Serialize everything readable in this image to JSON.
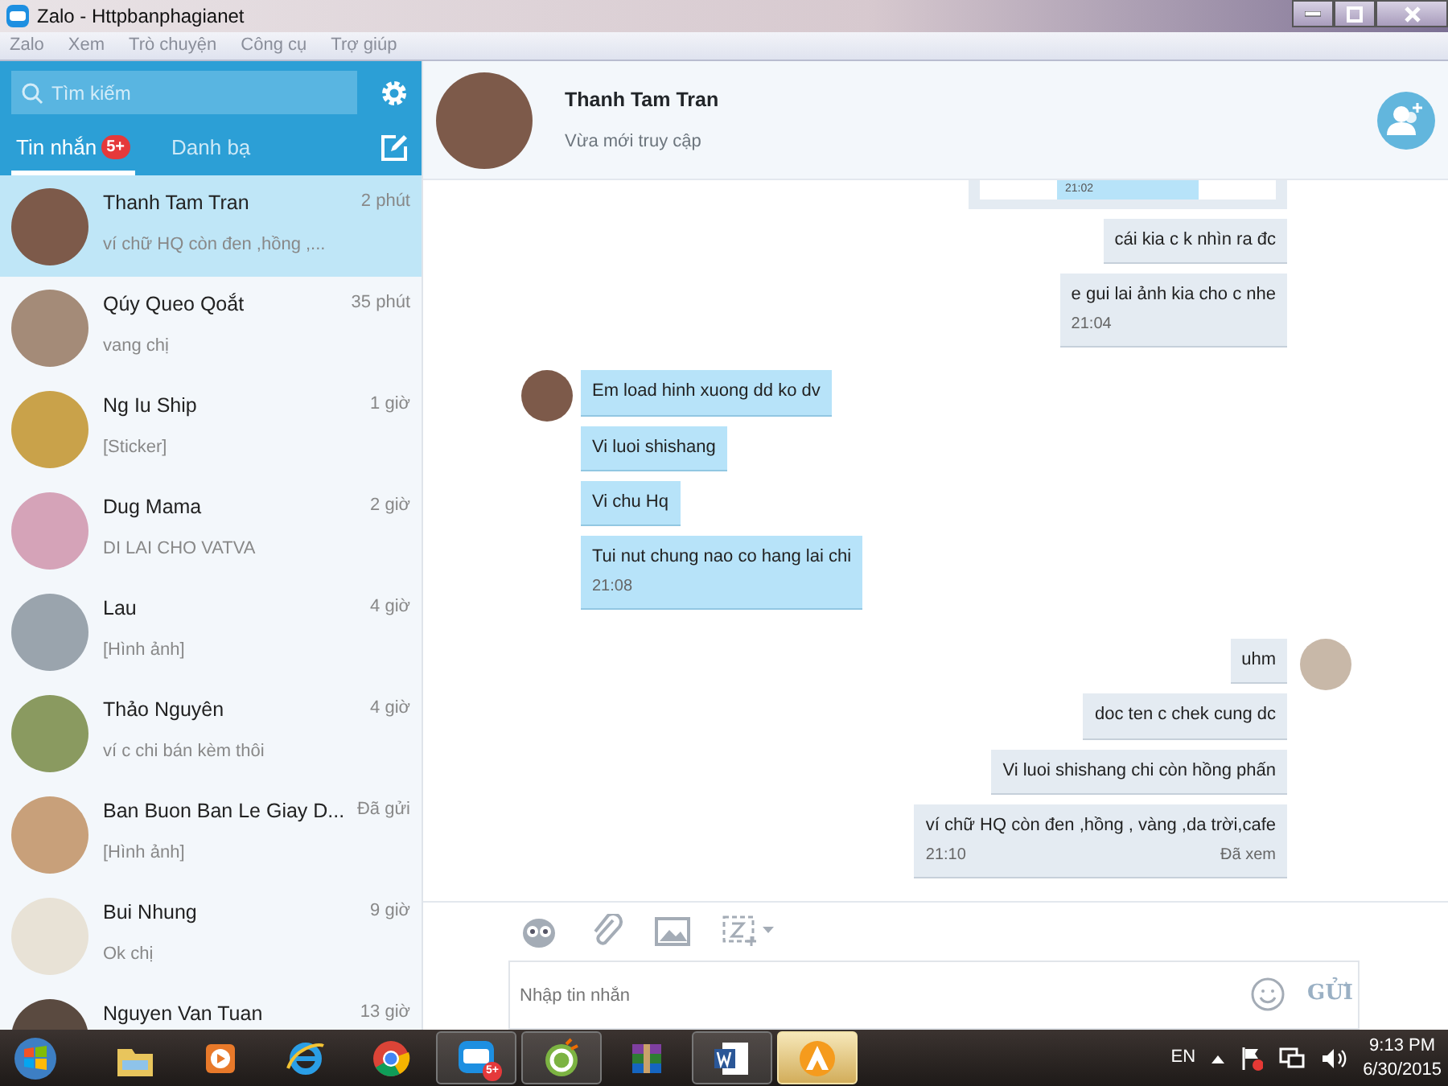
{
  "window": {
    "title": "Zalo - Httpbanphagianet"
  },
  "menu": [
    "Zalo",
    "Xem",
    "Trò chuyện",
    "Công cụ",
    "Trợ giúp"
  ],
  "sidebar": {
    "search": {
      "placeholder": "Tìm kiếm"
    },
    "tabs": [
      {
        "label": "Tin nhắn",
        "badge": "5+",
        "selected": true
      },
      {
        "label": "Danh bạ",
        "selected": false
      }
    ],
    "conversations": [
      {
        "name": "Thanh Tam Tran",
        "time": "2 phút",
        "preview": "ví chữ HQ còn đen ,hồng ,...",
        "selected": true
      },
      {
        "name": "Qúy Queo Qoắt",
        "time": "35 phút",
        "preview": "vang chị",
        "selected": false
      },
      {
        "name": "Ng Iu Ship",
        "time": "1 giờ",
        "preview": "[Sticker]",
        "selected": false
      },
      {
        "name": "Dug Mama",
        "time": "2 giờ",
        "preview": "DI LAI CHO VATVA",
        "selected": false
      },
      {
        "name": "Lau",
        "time": "4 giờ",
        "preview": "[Hình ảnh]",
        "selected": false
      },
      {
        "name": "Thảo Nguyên",
        "time": "4 giờ",
        "preview": "ví c chi bán kèm thôi",
        "selected": false
      },
      {
        "name": "Ban Buon Ban Le Giay D...",
        "time": "Đã gửi",
        "preview": "[Hình ảnh]",
        "selected": false
      },
      {
        "name": "Bui Nhung",
        "time": "9 giờ",
        "preview": "Ok chị",
        "selected": false
      },
      {
        "name": "Nguyen Van Tuan",
        "time": "13 giờ",
        "selected": false
      }
    ]
  },
  "chat": {
    "name": "Thanh Tam Tran",
    "status": "Vừa mới truy cập",
    "messages": [
      {
        "kind": "image",
        "outgoing": true,
        "time": "21:02"
      },
      {
        "kind": "text",
        "outgoing": true,
        "text": "cái kia c k nhìn ra đc"
      },
      {
        "kind": "text",
        "outgoing": true,
        "text": "e gui lai ảnh kia cho c nhe",
        "time": "21:04"
      },
      {
        "kind": "text",
        "outgoing": false,
        "avatar": true,
        "text": "Em load hinh xuong dd ko dv"
      },
      {
        "kind": "text",
        "outgoing": false,
        "text": "Vi luoi shishang"
      },
      {
        "kind": "text",
        "outgoing": false,
        "text": "Vi chu Hq"
      },
      {
        "kind": "text",
        "outgoing": false,
        "text": "Tui nut chung nao co hang lai chi",
        "time": "21:08"
      },
      {
        "kind": "text",
        "outgoing": true,
        "avatar": true,
        "text": "uhm"
      },
      {
        "kind": "text",
        "outgoing": true,
        "text": "doc ten c chek cung dc"
      },
      {
        "kind": "text",
        "outgoing": true,
        "text": "Vi luoi shishang chi còn hồng phấn"
      },
      {
        "kind": "text",
        "outgoing": true,
        "text": "ví chữ HQ còn đen ,hồng , vàng ,da trời,cafe",
        "time": "21:10",
        "status": "Đã xem"
      }
    ],
    "composer": {
      "placeholder": "Nhập tin nhắn",
      "send": "GỬI"
    }
  },
  "taskbar": {
    "apps": [
      {
        "kind": "folder",
        "open": false,
        "selected": false
      },
      {
        "kind": "player",
        "open": false,
        "selected": false
      },
      {
        "kind": "ie",
        "open": false,
        "selected": false
      },
      {
        "kind": "chrome",
        "open": false,
        "selected": false
      },
      {
        "kind": "zalo",
        "open": true,
        "selected": false,
        "badge": "5+"
      },
      {
        "kind": "coccoc",
        "open": true,
        "selected": false
      },
      {
        "kind": "winrar",
        "open": false,
        "selected": false
      },
      {
        "kind": "word",
        "open": true,
        "selected": false
      },
      {
        "kind": "app",
        "open": true,
        "selected": true
      }
    ],
    "language": "EN",
    "time": "9:13 PM",
    "date": "6/30/2015"
  }
}
